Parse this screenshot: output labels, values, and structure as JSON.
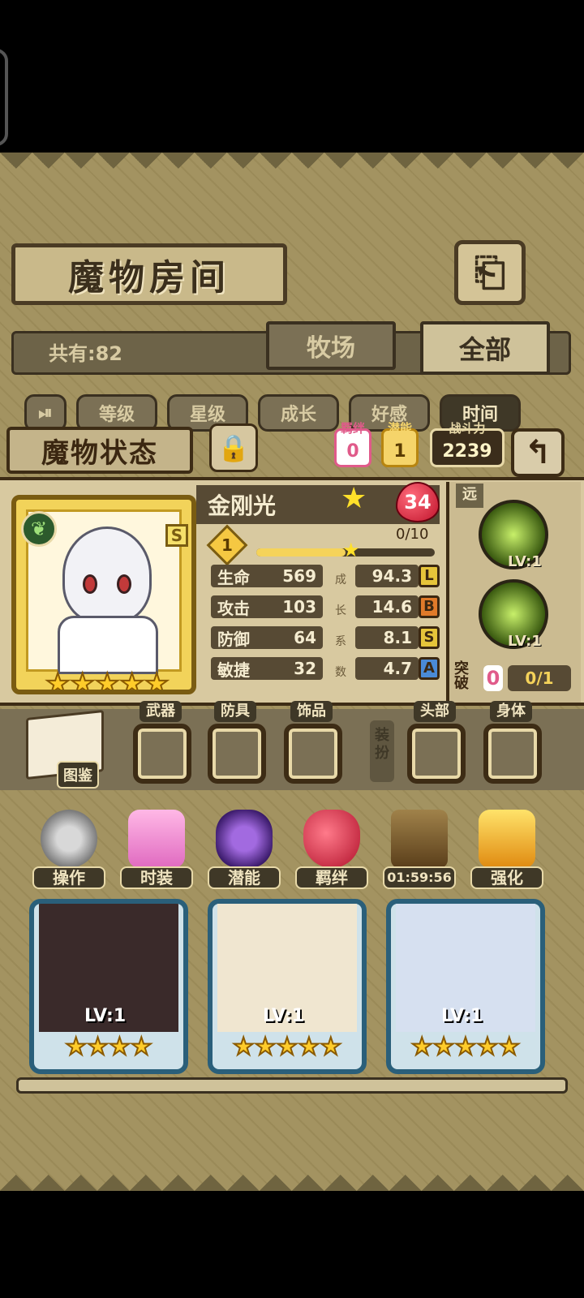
{
  "header": {
    "title": "魔物房间",
    "back_icon": "return-arrow-icon"
  },
  "roster": {
    "count_text": "共有:82",
    "tabs": [
      "牧场",
      "全部"
    ],
    "active_tab": "全部"
  },
  "sort": {
    "toggle_icon": "play-pause-icon",
    "buttons": [
      "等级",
      "星级",
      "成长",
      "好感",
      "时间"
    ],
    "active": "时间"
  },
  "status": {
    "banner": "魔物状态",
    "lock_icon": "padlock-icon",
    "bond_label": "羁绊",
    "bond_value": "0",
    "potential_label": "潜能",
    "potential_value": "1",
    "power_label": "战斗力",
    "power_value": "2239",
    "return_icon": "back-arrow-icon"
  },
  "monster": {
    "name": "金刚光",
    "level": "34",
    "rarity": "S",
    "element_icon": "leaf-icon",
    "stars": 5,
    "break_level": "1",
    "exp_text": "0/10",
    "exp_fraction": 0.5,
    "stats": [
      {
        "label": "生命",
        "value": "569",
        "growth": "94.3",
        "grade": "L",
        "grade_color": "#e6c43a"
      },
      {
        "label": "攻击",
        "value": "103",
        "growth": "14.6",
        "grade": "B",
        "grade_color": "#e07a2a"
      },
      {
        "label": "防御",
        "value": "64",
        "growth": "8.1",
        "grade": "S",
        "grade_color": "#e6c43a"
      },
      {
        "label": "敏捷",
        "value": "32",
        "growth": "4.7",
        "grade": "A",
        "grade_color": "#4a8ad6"
      }
    ],
    "growth_chars": [
      "成",
      "长",
      "系",
      "数"
    ]
  },
  "skills": {
    "range": "远",
    "items": [
      {
        "icon": "lyre-skill-icon",
        "level": "LV:1"
      },
      {
        "icon": "arrow-volley-skill-icon",
        "level": "LV:1"
      }
    ],
    "break_label": "突破",
    "break_count": "0",
    "break_progress": "0/1"
  },
  "equipment": {
    "codex_label": "图鉴",
    "codex_icon": "book-icon",
    "slots": [
      "武器",
      "防具",
      "饰品",
      "头部",
      "身体"
    ],
    "vertical_label": "装扮"
  },
  "actions": [
    {
      "label": "操作",
      "icon": "gear-icon"
    },
    {
      "label": "时装",
      "icon": "outfit-icon"
    },
    {
      "label": "潜能",
      "icon": "demon-icon"
    },
    {
      "label": "羁绊",
      "icon": "hearts-icon"
    },
    {
      "label": "01:59:56",
      "icon": "refresh-icon"
    },
    {
      "label": "强化",
      "icon": "upgrade-arrows-icon"
    }
  ],
  "monsters": [
    {
      "level": "LV:1",
      "stars": 4,
      "bg": "#3a2a2a"
    },
    {
      "level": "LV:1",
      "stars": 5,
      "bg": "#f0e6d0"
    },
    {
      "level": "LV:1",
      "stars": 5,
      "bg": "#d6e0f0"
    }
  ],
  "colors": {
    "panel": "#d8c9a0",
    "dark": "#3f3827",
    "accent": "#f5d35a",
    "card_border": "#2a5f7a"
  }
}
